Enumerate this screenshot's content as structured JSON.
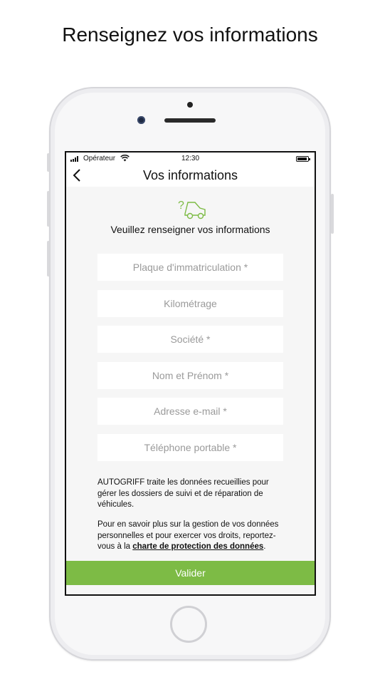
{
  "headline": "Renseignez vos informations",
  "status_bar": {
    "carrier": "Opérateur",
    "time": "12:30"
  },
  "nav": {
    "title": "Vos informations",
    "back_icon": "chevron-left-icon"
  },
  "icon": {
    "name": "car-question-icon",
    "glyph": "?",
    "color": "#7dbb45"
  },
  "subtitle": "Veuillez renseigner vos informations",
  "fields": [
    {
      "placeholder": "Plaque d'immatriculation *",
      "value": ""
    },
    {
      "placeholder": "Kilométrage",
      "value": ""
    },
    {
      "placeholder": "Société *",
      "value": ""
    },
    {
      "placeholder": "Nom et Prénom *",
      "value": ""
    },
    {
      "placeholder": "Adresse e-mail *",
      "value": ""
    },
    {
      "placeholder": "Téléphone portable *",
      "value": ""
    }
  ],
  "info": {
    "paragraph1": "AUTOGRIFF traite les données recueillies pour gérer les dossiers de suivi et de réparation de véhicules.",
    "paragraph2_prefix": "Pour en savoir plus sur la gestion de vos données personnelles et pour exercer vos droits, reportez-vous à la ",
    "paragraph2_link": "charte de protection des données",
    "paragraph2_suffix": "."
  },
  "submit_label": "Valider",
  "colors": {
    "accent": "#7dbb45",
    "background": "#f6f6f6"
  }
}
